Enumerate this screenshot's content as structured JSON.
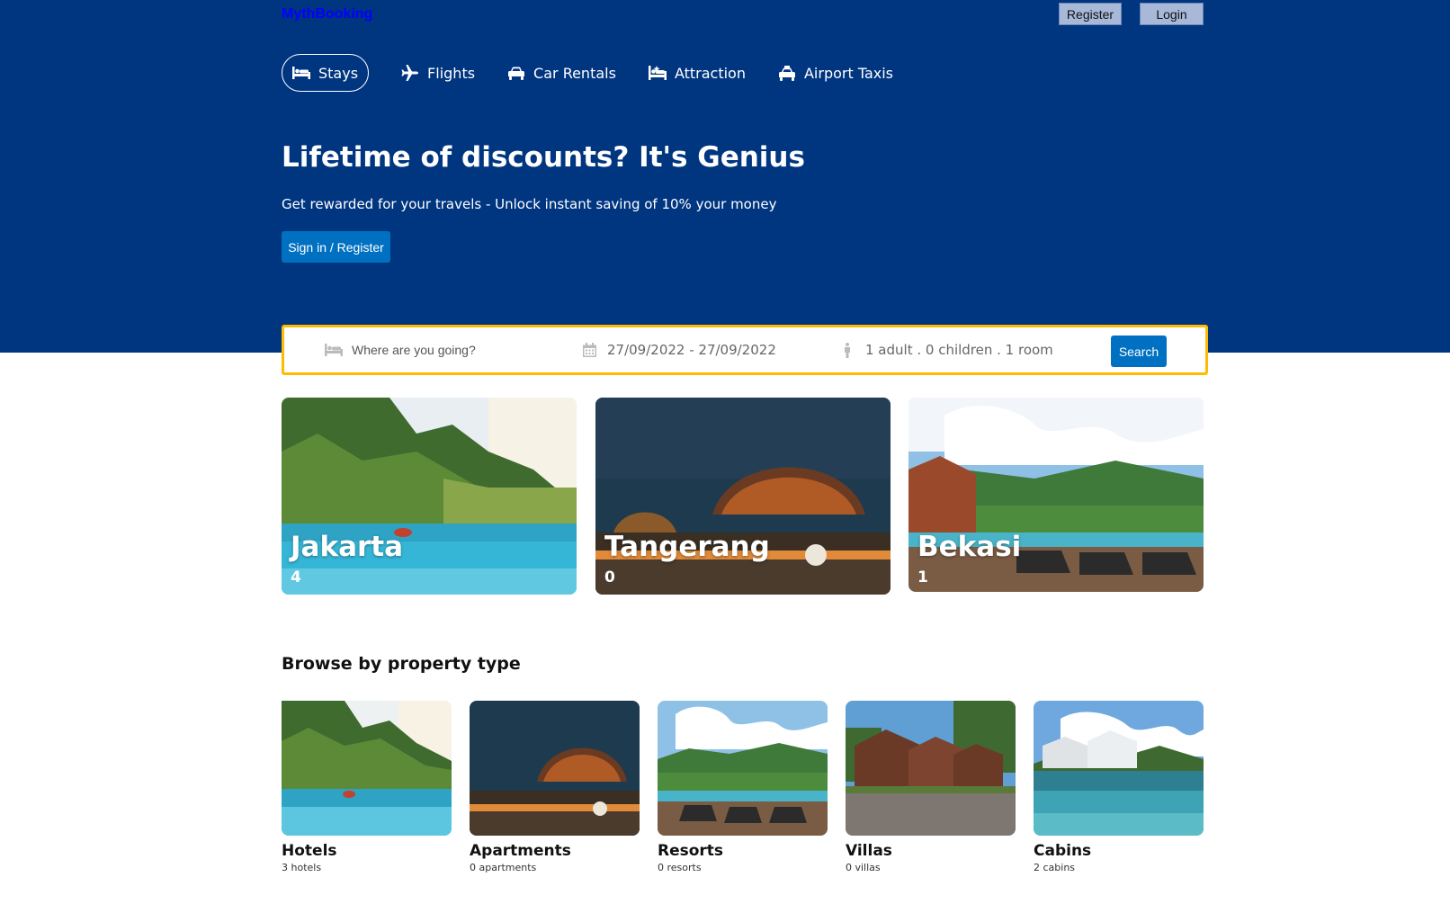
{
  "header": {
    "logo": "MythBooking",
    "register_label": "Register",
    "login_label": "Login"
  },
  "nav": [
    {
      "label": "Stays",
      "icon": "bed-icon",
      "active": true
    },
    {
      "label": "Flights",
      "icon": "plane-icon",
      "active": false
    },
    {
      "label": "Car Rentals",
      "icon": "car-icon",
      "active": false
    },
    {
      "label": "Attraction",
      "icon": "attraction-icon",
      "active": false
    },
    {
      "label": "Airport Taxis",
      "icon": "taxi-icon",
      "active": false
    }
  ],
  "hero": {
    "title": "Lifetime of discounts? It's Genius",
    "subtitle": "Get rewarded for your travels - Unlock instant saving of 10% your money",
    "button_label": "Sign in / Register"
  },
  "search": {
    "destination_placeholder": "Where are you going?",
    "date_range": "27/09/2022 - 27/09/2022",
    "options": "1 adult . 0 children . 1 room",
    "button_label": "Search"
  },
  "cities": [
    {
      "name": "Jakarta",
      "count": "4"
    },
    {
      "name": "Tangerang",
      "count": "0"
    },
    {
      "name": "Bekasi",
      "count": "1"
    }
  ],
  "property_section": {
    "title": "Browse by property type",
    "types": [
      {
        "title": "Hotels",
        "count": "3 hotels"
      },
      {
        "title": "Apartments",
        "count": "0 apartments"
      },
      {
        "title": "Resorts",
        "count": "0 resorts"
      },
      {
        "title": "Villas",
        "count": "0 villas"
      },
      {
        "title": "Cabins",
        "count": "2 cabins"
      }
    ]
  },
  "colors": {
    "hero_bg": "#003580",
    "primary_button": "#0071c2",
    "search_border": "#febb02",
    "logo": "#0000ff"
  }
}
